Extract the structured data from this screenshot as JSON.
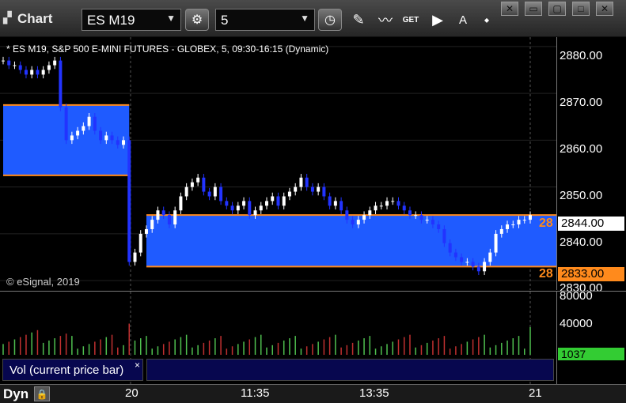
{
  "toolbar": {
    "title": "Chart",
    "symbol": "ES M19",
    "interval": "5",
    "dropdown_glyph": "▼",
    "icons": [
      "chart-icon",
      "settings-gear-icon",
      "clock-icon",
      "pencil-icon",
      "indicator-icon",
      "get-icon",
      "play-icon",
      "alert-icon",
      "cursor-icon"
    ],
    "get_label": "GET",
    "alert_label": "A"
  },
  "window_buttons": [
    "close-icon",
    "restore-icon",
    "maximize-icon",
    "close-x-icon"
  ],
  "chart": {
    "info": "* ES M19, S&P 500 E-MINI FUTURES - GLOBEX, 5, 09:30-16:15 (Dynamic)",
    "copyright": "© eSignal, 2019",
    "y_ticks": [
      "2880.00",
      "2870.00",
      "2860.00",
      "2850.00",
      "2840.00",
      "2830.00"
    ],
    "last_price": "2844.00",
    "level_price": "2833.00",
    "level_left_label_1": "28",
    "level_left_label_2": "28",
    "colors": {
      "zone": "#1f5bff",
      "level": "#ff8a1c",
      "up": "#ffffff",
      "down": "#2233ff",
      "grid": "#555555",
      "vol_up": "#4fc04f",
      "vol_down": "#c03030"
    }
  },
  "chart_data": {
    "type": "candlestick",
    "ylim": [
      2828,
      2882
    ],
    "zones": [
      {
        "low": 2852.5,
        "high": 2867.5,
        "x_start": 0,
        "x_end": 22
      },
      {
        "low": 2833,
        "high": 2844,
        "x_start": 25,
        "x_end": 97
      }
    ],
    "closes": [
      2877,
      2876,
      2876,
      2875,
      2874,
      2875,
      2874,
      2875,
      2876,
      2877,
      2867,
      2860,
      2861,
      2862,
      2863,
      2865,
      2862,
      2860,
      2861,
      2860,
      2859,
      2860,
      2834,
      2836,
      2840,
      2841,
      2843,
      2845,
      2844,
      2842,
      2845,
      2848,
      2850,
      2851,
      2852,
      2849,
      2848,
      2850,
      2847,
      2846,
      2845,
      2846,
      2847,
      2844,
      2845,
      2846,
      2847,
      2848,
      2846,
      2848,
      2849,
      2850,
      2852,
      2850,
      2849,
      2850,
      2848,
      2846,
      2847,
      2845,
      2843,
      2842,
      2843,
      2844,
      2845,
      2846,
      2846,
      2847,
      2847,
      2846,
      2845,
      2844,
      2844,
      2843,
      2843,
      2842,
      2841,
      2838,
      2836,
      2835,
      2834,
      2834,
      2833,
      2832,
      2834,
      2836,
      2840,
      2841,
      2842,
      2842,
      2843,
      2843,
      2844
    ],
    "volume": {
      "ylim": [
        0,
        80000
      ],
      "y_ticks": [
        "80000",
        "40000"
      ],
      "last": "1037"
    },
    "x_ticks": [
      "20",
      "11:35",
      "13:35",
      "21"
    ]
  },
  "volume_panel": {
    "label": "Vol (current price bar)",
    "close_glyph": "×"
  },
  "bottom_bar": {
    "mode": "Dyn",
    "lock_glyph": "🔒"
  }
}
